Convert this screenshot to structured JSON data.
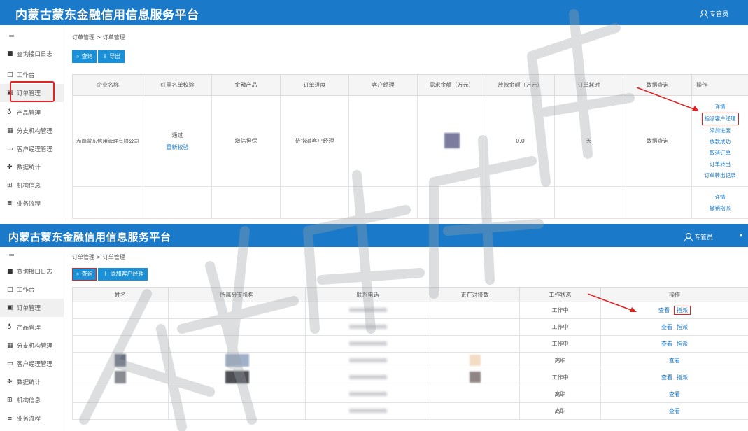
{
  "app_title": "内蒙古蒙东金融信用信息服务平台",
  "user_label": "专管员",
  "caret": "▾",
  "menu_toggle": "≡",
  "sidebar": [
    {
      "label": "查询接口日志",
      "icon": "document-icon",
      "glyph": "■"
    },
    {
      "label": "工作台",
      "icon": "monitor-icon",
      "glyph": "□"
    },
    {
      "label": "订单管理",
      "icon": "order-icon",
      "glyph": "▣"
    },
    {
      "label": "产品管理",
      "icon": "user-icon",
      "glyph": "♁"
    },
    {
      "label": "分支机构管理",
      "icon": "calendar-icon",
      "glyph": "▦"
    },
    {
      "label": "客户经理管理",
      "icon": "folder-icon",
      "glyph": "▭"
    },
    {
      "label": "数据统计",
      "icon": "chart-icon",
      "glyph": "✤"
    },
    {
      "label": "机构信息",
      "icon": "grid-icon",
      "glyph": "⊞"
    },
    {
      "label": "业务流程",
      "icon": "list-icon",
      "glyph": "≣"
    }
  ],
  "panel1": {
    "breadcrumb": "订单管理 > 订单管理",
    "buttons": {
      "query": "查询",
      "export": "导出"
    },
    "columns": [
      "企业名称",
      "红黑名单校验",
      "金融产品",
      "订单进度",
      "客户经理",
      "需求金额（万元）",
      "放款金额（万元）",
      "订单耗时",
      "数据查询",
      "操作"
    ],
    "row1": {
      "company": "赤峰蒙东信用管理有限公司",
      "check_status": "通过",
      "recheck": "重新校验",
      "product": "增信担保",
      "progress": "待指派客户经理",
      "loan_amount": "0.0",
      "duration": "天",
      "data_query": "数据查询",
      "ops": [
        "详情",
        "指派客户经理",
        "添加进度",
        "放款成功",
        "取消订单",
        "订单转出",
        "订单转出记录"
      ]
    },
    "row2": {
      "ops": [
        "详情",
        "撤销指派"
      ]
    }
  },
  "panel2": {
    "breadcrumb": "订单管理 > 订单管理",
    "buttons": {
      "query": "查询",
      "add": "添加客户经理"
    },
    "columns": [
      "姓名",
      "所属分支机构",
      "联系电话",
      "正在对接数",
      "工作状态",
      "操作"
    ],
    "view_label": "查看",
    "assign_label": "指派",
    "rows": [
      {
        "status": "工作中",
        "assign": true
      },
      {
        "status": "工作中",
        "assign": true
      },
      {
        "status": "工作中",
        "assign": true
      },
      {
        "status": "离职",
        "assign": false
      },
      {
        "status": "工作中",
        "assign": true
      },
      {
        "status": "离职",
        "assign": false
      },
      {
        "status": "离职",
        "assign": false
      }
    ]
  },
  "colors": {
    "header": "#1a7ac9",
    "button": "#1a90d8",
    "link": "#1a7ac9",
    "highlight": "#e02424"
  }
}
